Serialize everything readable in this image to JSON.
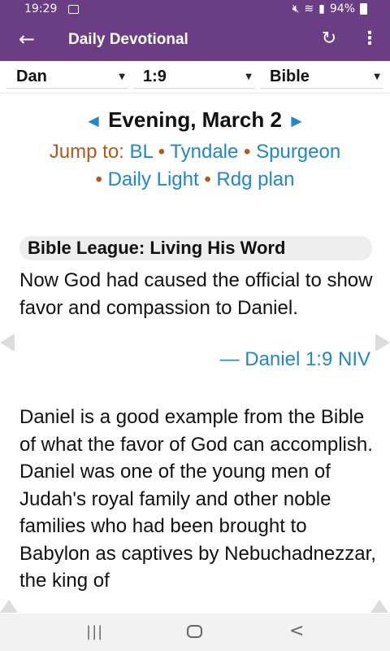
{
  "status": {
    "time": "19:29",
    "battery": "94%",
    "icons": [
      "image-icon",
      "mute-icon",
      "wifi-icon",
      "signal-icon",
      "battery-icon"
    ]
  },
  "appbar": {
    "title": "Daily Devotional",
    "back_icon": "arrow-left-icon",
    "refresh_icon": "refresh-icon",
    "more_icon": "more-vert-icon"
  },
  "selectors": {
    "book": "Dan",
    "verse": "1:9",
    "version": "Bible"
  },
  "content": {
    "heading": "Evening, March 2",
    "jump_label": "Jump to:",
    "jump_links": [
      "BL",
      "Tyndale",
      "Spurgeon",
      "Daily Light",
      "Rdg plan"
    ],
    "section_title": "Bible League: Living His Word",
    "verse_text": "Now God had caused the official to show favor and compassion to Daniel.",
    "verse_ref": "— Daniel 1:9 NIV",
    "body": "Daniel is a good example from the Bible of what the favor of God can accomplish. Daniel was one of the young men of Judah's royal family and other noble families who had been brought to Babylon as captives by Nebuchadnezzar, the king of"
  },
  "colors": {
    "primary": "#6a3d84",
    "link": "#1e88c8",
    "jump_label": "#b5561b"
  }
}
